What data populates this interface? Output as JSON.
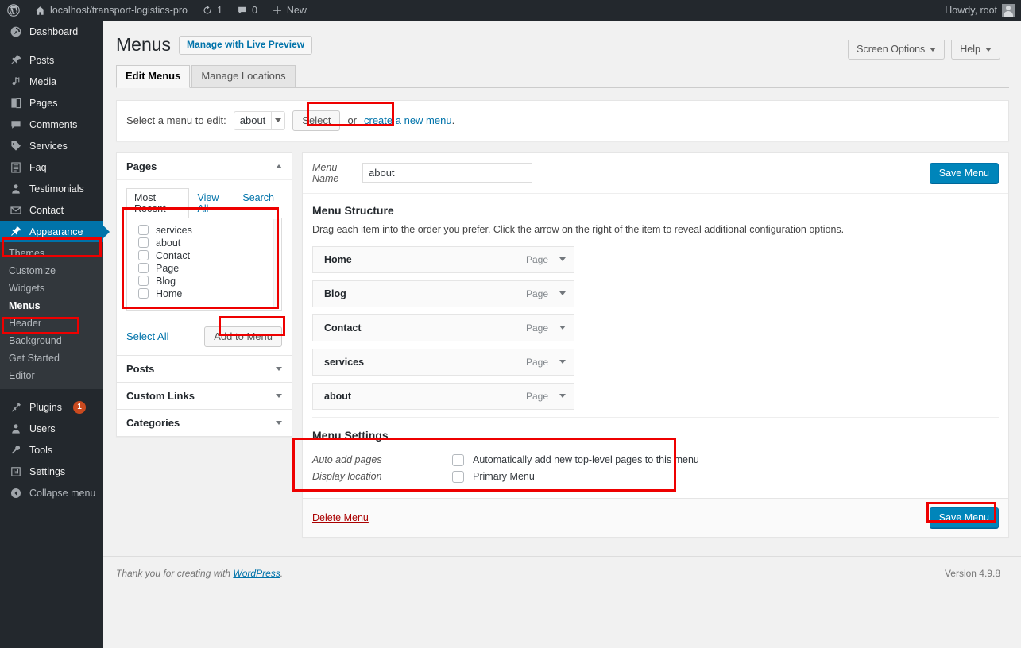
{
  "adminbar": {
    "wp_logo_icon": "wordpress-logo-icon",
    "site_home_icon": "home-icon",
    "site_name": "localhost/transport-logistics-pro",
    "updates_icon": "updates-icon",
    "updates_count": "1",
    "comments_icon": "comment-bubble-icon",
    "comments_count": "0",
    "new_icon": "plus-icon",
    "new_label": "New",
    "howdy": "Howdy, root"
  },
  "sidebar": {
    "items": [
      {
        "label": "Dashboard",
        "icon": "dashboard-icon"
      },
      {
        "label": "Posts",
        "icon": "pin-icon"
      },
      {
        "label": "Media",
        "icon": "media-icon"
      },
      {
        "label": "Pages",
        "icon": "pages-icon"
      },
      {
        "label": "Comments",
        "icon": "comment-bubble-icon"
      },
      {
        "label": "Services",
        "icon": "tag-icon"
      },
      {
        "label": "Faq",
        "icon": "grid-icon"
      },
      {
        "label": "Testimonials",
        "icon": "user-icon"
      },
      {
        "label": "Contact",
        "icon": "envelope-icon"
      },
      {
        "label": "Appearance",
        "icon": "paintbrush-icon"
      }
    ],
    "submenu": [
      {
        "label": "Themes"
      },
      {
        "label": "Customize"
      },
      {
        "label": "Widgets"
      },
      {
        "label": "Menus"
      },
      {
        "label": "Header"
      },
      {
        "label": "Background"
      },
      {
        "label": "Get Started"
      },
      {
        "label": "Editor"
      }
    ],
    "items_bottom": [
      {
        "label": "Plugins",
        "icon": "plug-icon",
        "badge": "1"
      },
      {
        "label": "Users",
        "icon": "user-icon"
      },
      {
        "label": "Tools",
        "icon": "wrench-icon"
      },
      {
        "label": "Settings",
        "icon": "settings-icon"
      },
      {
        "label": "Collapse menu",
        "icon": "collapse-arrow-icon"
      }
    ],
    "current_item": "Appearance",
    "active_submenu": "Menus"
  },
  "screen_meta": {
    "screen_options_label": "Screen Options",
    "help_label": "Help"
  },
  "header": {
    "title": "Menus",
    "live_preview_label": "Manage with Live Preview"
  },
  "tabs": [
    {
      "label": "Edit Menus",
      "active": true
    },
    {
      "label": "Manage Locations",
      "active": false
    }
  ],
  "menu_select": {
    "prompt": "Select a menu to edit:",
    "selected": "about",
    "options": [
      "about"
    ],
    "select_button": "Select",
    "or_text": "or",
    "create_link": "create a new menu",
    "period": "."
  },
  "pages_panel": {
    "title": "Pages",
    "collapse_icon": "chevron-up-icon",
    "tabs": [
      {
        "label": "Most Recent",
        "active": true
      },
      {
        "label": "View All",
        "active": false
      },
      {
        "label": "Search",
        "active": false
      }
    ],
    "items": [
      {
        "label": "services",
        "checked": false
      },
      {
        "label": "about",
        "checked": false
      },
      {
        "label": "Contact",
        "checked": false
      },
      {
        "label": "Page",
        "checked": false
      },
      {
        "label": "Blog",
        "checked": false
      },
      {
        "label": "Home",
        "checked": false
      }
    ],
    "select_all": "Select All",
    "add_to_menu": "Add to Menu"
  },
  "accordion_panels": [
    {
      "title": "Posts",
      "icon": "chevron-down-icon"
    },
    {
      "title": "Custom Links",
      "icon": "chevron-down-icon"
    },
    {
      "title": "Categories",
      "icon": "chevron-down-icon"
    }
  ],
  "menu_name": {
    "label": "Menu Name",
    "value": "about",
    "placeholder": "Menu Name",
    "save_label": "Save Menu"
  },
  "menu_structure": {
    "heading": "Menu Structure",
    "description": "Drag each item into the order you prefer. Click the arrow on the right of the item to reveal additional configuration options.",
    "items": [
      {
        "label": "Home",
        "type": "Page",
        "toggle_icon": "chevron-down-icon"
      },
      {
        "label": "Blog",
        "type": "Page",
        "toggle_icon": "chevron-down-icon"
      },
      {
        "label": "Contact",
        "type": "Page",
        "toggle_icon": "chevron-down-icon"
      },
      {
        "label": "services",
        "type": "Page",
        "toggle_icon": "chevron-down-icon"
      },
      {
        "label": "about",
        "type": "Page",
        "toggle_icon": "chevron-down-icon"
      }
    ]
  },
  "menu_settings": {
    "heading": "Menu Settings",
    "auto_add_label": "Auto add pages",
    "auto_add_checkbox_label": "Automatically add new top-level pages to this menu",
    "auto_add_checked": false,
    "display_location_label": "Display location",
    "display_location_checkbox_label": "Primary Menu",
    "display_location_checked": false
  },
  "bottom_bar": {
    "delete_label": "Delete Menu",
    "save_label": "Save Menu"
  },
  "footer": {
    "thanks_prefix": "Thank you for creating with ",
    "wordpress_link": "WordPress",
    "thanks_suffix": ".",
    "version": "Version 4.9.8"
  },
  "colors": {
    "accent": "#0073aa",
    "primary_button": "#0085ba",
    "admin_bg": "#23282d",
    "submenu_bg": "#32373c",
    "annotation": "#ee0000",
    "badge": "#ca4a1f"
  }
}
